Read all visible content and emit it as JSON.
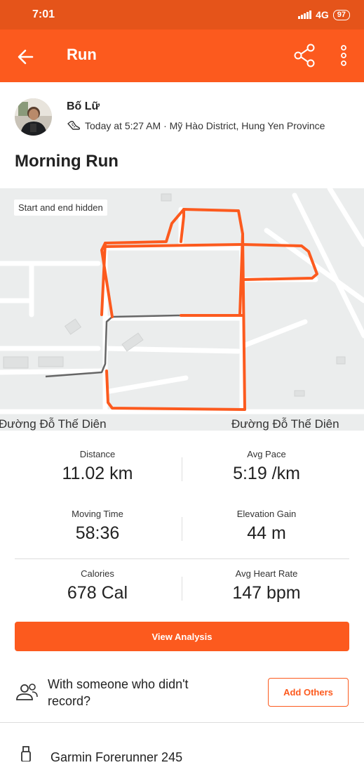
{
  "status_bar": {
    "time": "7:01",
    "network": "4G",
    "battery": "97"
  },
  "header": {
    "title": "Run"
  },
  "athlete": {
    "name": "Bố Lữ",
    "meta": "Today at 5:27 AM · Mỹ Hào District, Hung Yen Province"
  },
  "activity": {
    "title": "Morning Run"
  },
  "map": {
    "badge": "Start and end hidden",
    "street_left": "Đường Đỗ Thế Diên",
    "street_right": "Đường Đỗ Thế Diên"
  },
  "stats": [
    {
      "label": "Distance",
      "value": "11.02 km"
    },
    {
      "label": "Avg Pace",
      "value": "5:19 /km"
    },
    {
      "label": "Moving Time",
      "value": "58:36"
    },
    {
      "label": "Elevation Gain",
      "value": "44 m"
    },
    {
      "label": "Calories",
      "value": "678 Cal"
    },
    {
      "label": "Avg Heart Rate",
      "value": "147 bpm"
    }
  ],
  "actions": {
    "view_analysis": "View Analysis",
    "add_others": "Add Others"
  },
  "with_others": {
    "text": "With someone who didn't record?"
  },
  "gear": {
    "name": "Garmin Forerunner 245"
  },
  "colors": {
    "brand": "#fc5a1e",
    "status_bar": "#e5541a",
    "route": "#fc5a1e",
    "hidden_route": "#666666"
  },
  "icons": [
    "back-arrow-icon",
    "share-icon",
    "more-vertical-icon",
    "shoe-icon",
    "people-icon",
    "watch-icon"
  ]
}
